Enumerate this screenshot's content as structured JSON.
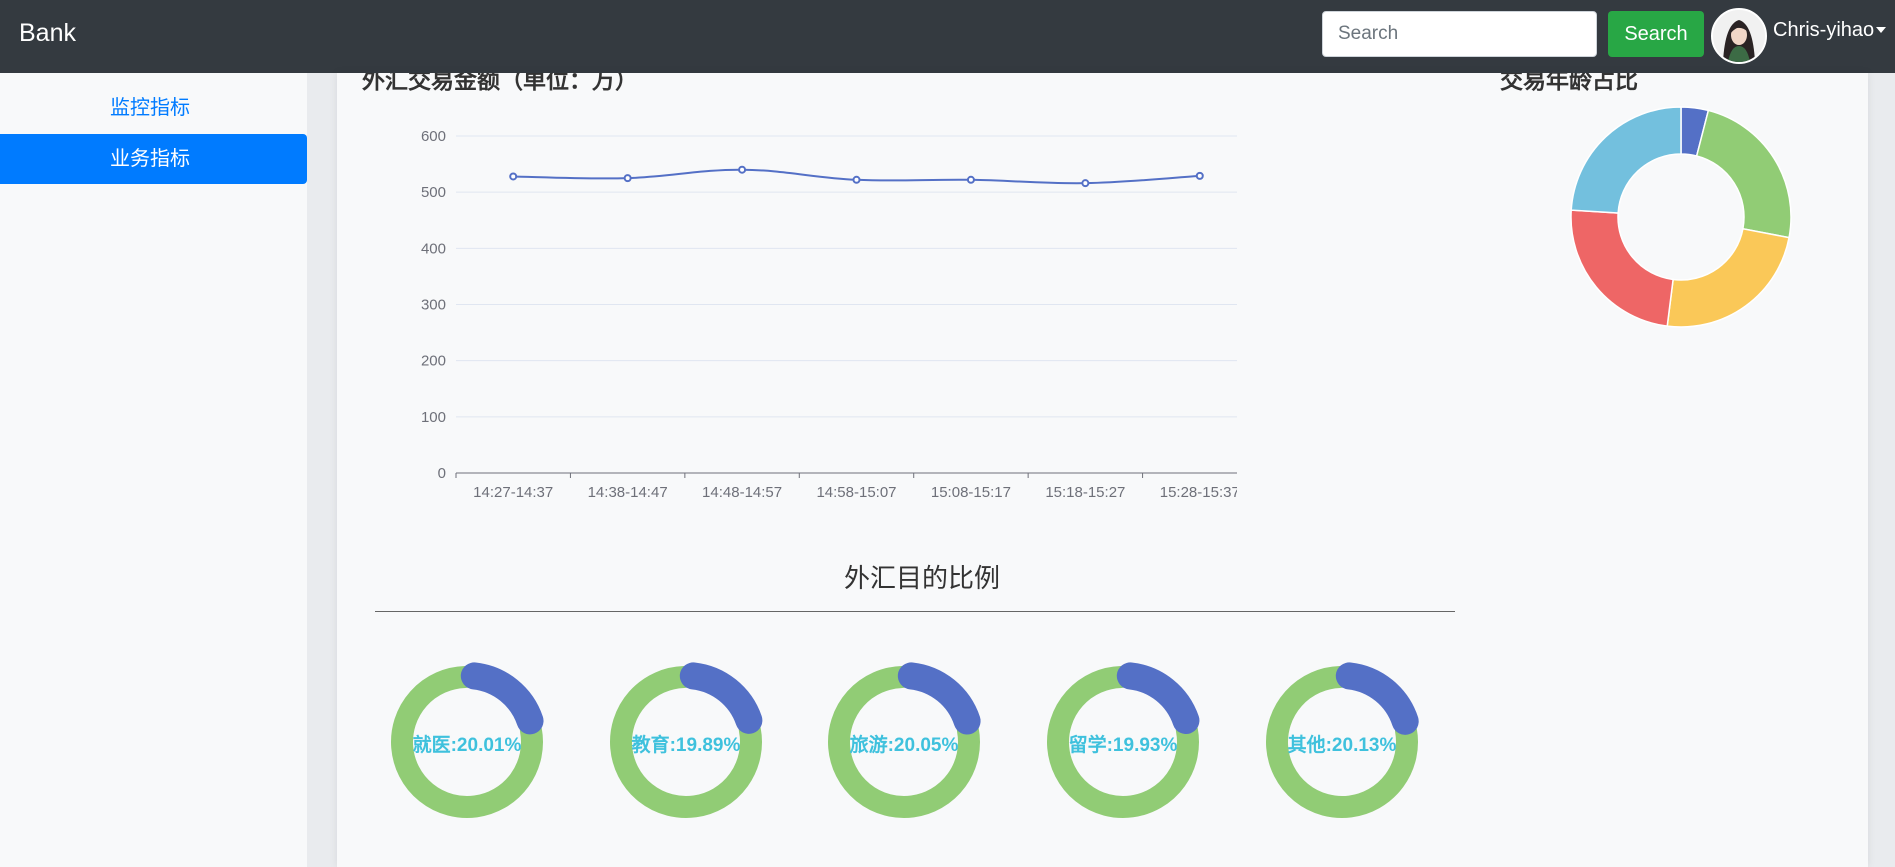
{
  "navbar": {
    "brand": "Bank",
    "search_placeholder": "Search",
    "search_button": "Search",
    "username": "Chris-yihao"
  },
  "sidebar": {
    "items": [
      {
        "label": "监控指标",
        "active": false
      },
      {
        "label": "业务指标",
        "active": true
      }
    ]
  },
  "colors": {
    "navbar_bg": "#343a40",
    "primary": "#007bff",
    "success": "#28a745",
    "line": "#5470c6",
    "pie_green": "#91cc75",
    "pie_blue": "#5470c6",
    "pie_yellow": "#fac858",
    "pie_red": "#ee6666",
    "pie_cyan": "#73c0de",
    "donut_label": "#3fc1dd"
  },
  "chart_data": [
    {
      "type": "line",
      "title": "外汇交易金额（单位：万）",
      "x": [
        "14:27-14:37",
        "14:38-14:47",
        "14:48-14:57",
        "14:58-15:07",
        "15:08-15:17",
        "15:18-15:27",
        "15:28-15:37"
      ],
      "series": [
        {
          "values": [
            528,
            525,
            540,
            522,
            522,
            516,
            529
          ]
        }
      ],
      "yticks": [
        0,
        100,
        200,
        300,
        400,
        500,
        600
      ],
      "ylim": [
        0,
        600
      ],
      "smooth": true,
      "grid": true
    },
    {
      "type": "pie",
      "title": "交易年龄占比",
      "donut": true,
      "values": [
        4,
        24,
        24,
        24,
        24
      ],
      "colors": [
        "#5470c6",
        "#91cc75",
        "#fac858",
        "#ee6666",
        "#73c0de"
      ]
    }
  ],
  "purpose": {
    "title": "外汇目的比例",
    "items": [
      {
        "label": "就医:20.01%",
        "value": 20.01
      },
      {
        "label": "教育:19.89%",
        "value": 19.89
      },
      {
        "label": "旅游:20.05%",
        "value": 20.05
      },
      {
        "label": "留学:19.93%",
        "value": 19.93
      },
      {
        "label": "其他:20.13%",
        "value": 20.13
      }
    ]
  }
}
